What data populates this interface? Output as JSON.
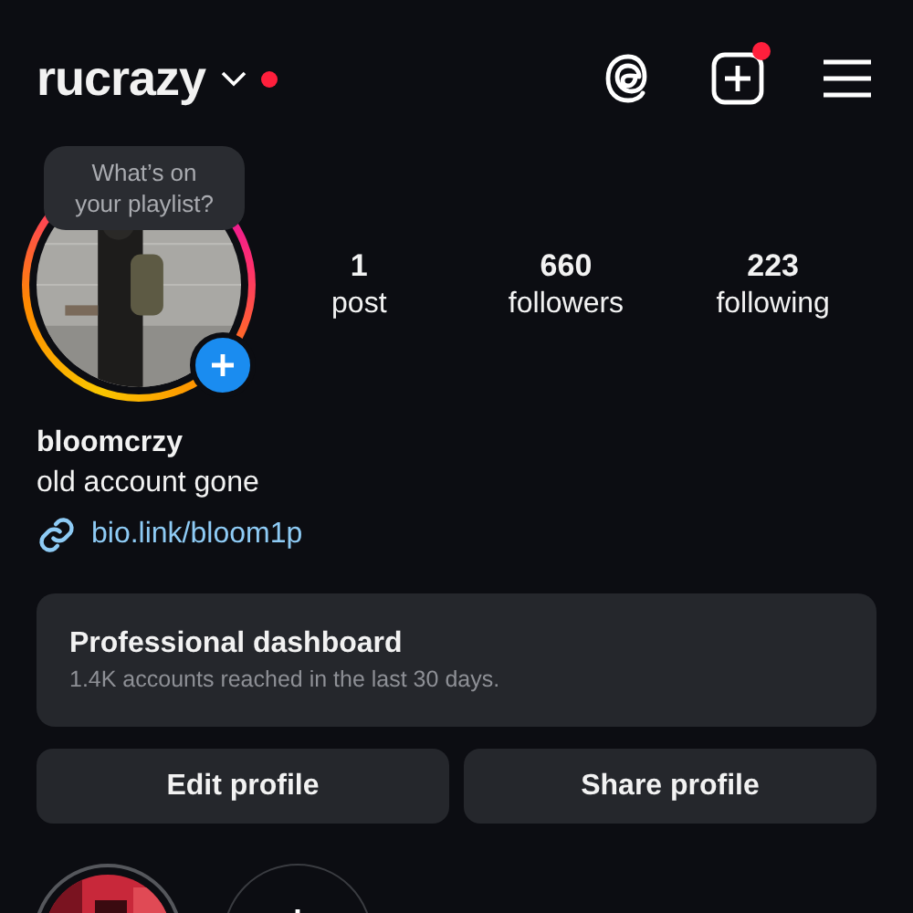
{
  "header": {
    "username": "rucrazy",
    "unread": true,
    "create_unread": true
  },
  "profile": {
    "tooltip": "What’s on your playlist?",
    "has_story": true
  },
  "stats": [
    {
      "value": "1",
      "label": "post"
    },
    {
      "value": "660",
      "label": "followers"
    },
    {
      "value": "223",
      "label": "following"
    }
  ],
  "name": "bloomcrzy",
  "bio": "old account gone",
  "link": "bio.link/bloom1p",
  "dashboard": {
    "title": "Professional dashboard",
    "subtitle": "1.4K accounts reached in the last 30 days."
  },
  "buttons": [
    "Edit profile",
    "Share profile"
  ],
  "highlights": [
    {
      "kind": "picture"
    },
    {
      "kind": "new"
    }
  ]
}
